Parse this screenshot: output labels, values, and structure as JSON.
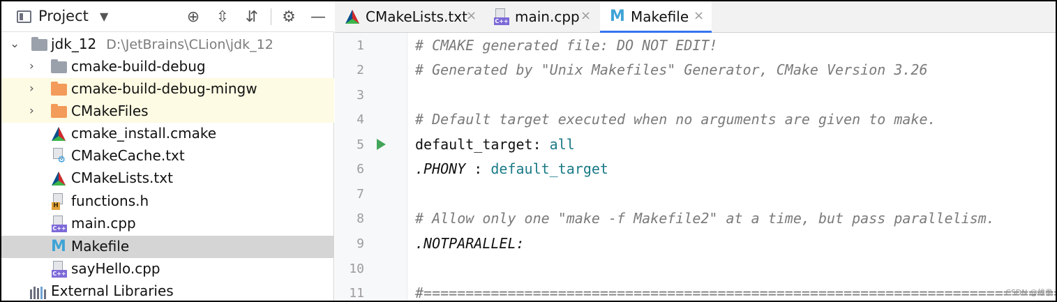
{
  "project_panel": {
    "title": "Project",
    "caret": "▼",
    "toolbar": {
      "locate": "⊕",
      "expand": "⇳",
      "collapse": "⇵",
      "settings": "⚙",
      "hide": "—"
    },
    "tree": [
      {
        "label": "jdk_12",
        "path": "D:\\JetBrains\\CLion\\jdk_12",
        "icon": "folder-icon",
        "chevron": "⌄"
      },
      {
        "label": "cmake-build-debug",
        "icon": "folder-icon",
        "chevron": "›"
      },
      {
        "label": "cmake-build-debug-mingw",
        "icon": "folder-icon",
        "chevron": "›"
      },
      {
        "label": "CMakeFiles",
        "icon": "folder-icon",
        "chevron": "›"
      },
      {
        "label": "cmake_install.cmake",
        "icon": "cmake-icon"
      },
      {
        "label": "CMakeCache.txt",
        "icon": "cmake-cache-icon"
      },
      {
        "label": "CMakeLists.txt",
        "icon": "cmake-icon"
      },
      {
        "label": "functions.h",
        "icon": "header-file-icon",
        "badge": "H"
      },
      {
        "label": "main.cpp",
        "icon": "cpp-file-icon",
        "badge": "C++"
      },
      {
        "label": "Makefile",
        "icon": "makefile-icon",
        "glyph": "M"
      },
      {
        "label": "sayHello.cpp",
        "icon": "cpp-file-icon",
        "badge": "C++"
      },
      {
        "label": "External Libraries",
        "icon": "libraries-icon"
      }
    ]
  },
  "tabs": [
    {
      "label": "CMakeLists.txt",
      "close": "×",
      "icon": "cmake-icon"
    },
    {
      "label": "main.cpp",
      "close": "×",
      "icon": "cpp-file-icon",
      "badge": "C++"
    },
    {
      "label": "Makefile",
      "close": "×",
      "icon": "makefile-icon",
      "glyph": "M"
    }
  ],
  "editor": {
    "line_numbers": [
      "1",
      "2",
      "3",
      "4",
      "5",
      "6",
      "7",
      "8",
      "9",
      "10",
      "11"
    ],
    "lines": {
      "l1": "# CMAKE generated file: DO NOT EDIT!",
      "l2": "# Generated by \"Unix Makefiles\" Generator, CMake Version 3.26",
      "l4": "# Default target executed when no arguments are given to make.",
      "l5_key": "default_target:",
      "l5_val": "all",
      "l6_key": ".PHONY",
      "l6_sep": " : ",
      "l6_val": "default_target",
      "l8": "# Allow only one \"make -f Makefile2\" at a time, but pass parallelism.",
      "l9": ".NOTPARALLEL:",
      "l11": "#============================================================================="
    }
  },
  "watermark": "CSDN @雄拳",
  "colors": {
    "accent": "#3574f0",
    "run": "#44a55a",
    "highlight_row": "#fdfbe3",
    "selected_row": "#d5d5d5",
    "orange_folder": "#f39b5a",
    "gray_folder": "#9aa1ab",
    "value_teal": "#1a7a86"
  }
}
